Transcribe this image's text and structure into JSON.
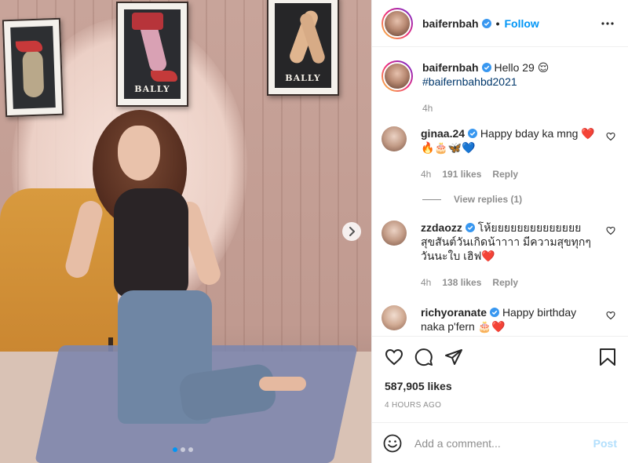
{
  "post": {
    "author": "baifernbah",
    "follow_label": "Follow",
    "separator": "•",
    "caption_text": "Hello 29 😌",
    "caption_hashtag": "#baifernbahbd2021",
    "caption_age": "4h",
    "photo_poster_text": "BALLY",
    "carousel": {
      "count": 3,
      "active": 0
    }
  },
  "comments": [
    {
      "username": "ginaa.24",
      "text": "Happy bday ka mng ❤️🔥🎂🦋💙",
      "age": "4h",
      "likes": "191 likes",
      "reply_label": "Reply",
      "view_replies": "View replies (1)"
    },
    {
      "username": "zzdaozz",
      "text": "โห้ยยยยยยยยยยยยยย สุขสันต์วันเกิดน้าาาา มีความสุขทุกๆวันนะใบ เฮิฟ❤️",
      "age": "4h",
      "likes": "138 likes",
      "reply_label": "Reply"
    },
    {
      "username": "richyoranate",
      "text": "Happy birthday naka p'fern 🎂❤️"
    }
  ],
  "footer": {
    "likes": "587,905 likes",
    "time": "4 HOURS AGO",
    "comment_placeholder": "Add a comment...",
    "post_label": "Post"
  },
  "colors": {
    "accent": "#0095f6",
    "verified": "#3897f0",
    "muted": "#8e8e8e",
    "post_disabled": "#b2dffc"
  },
  "icons": [
    "verified-badge-icon",
    "more-icon",
    "heart-icon",
    "comment-icon",
    "share-icon",
    "bookmark-icon",
    "emoji-icon",
    "chevron-right-icon"
  ]
}
